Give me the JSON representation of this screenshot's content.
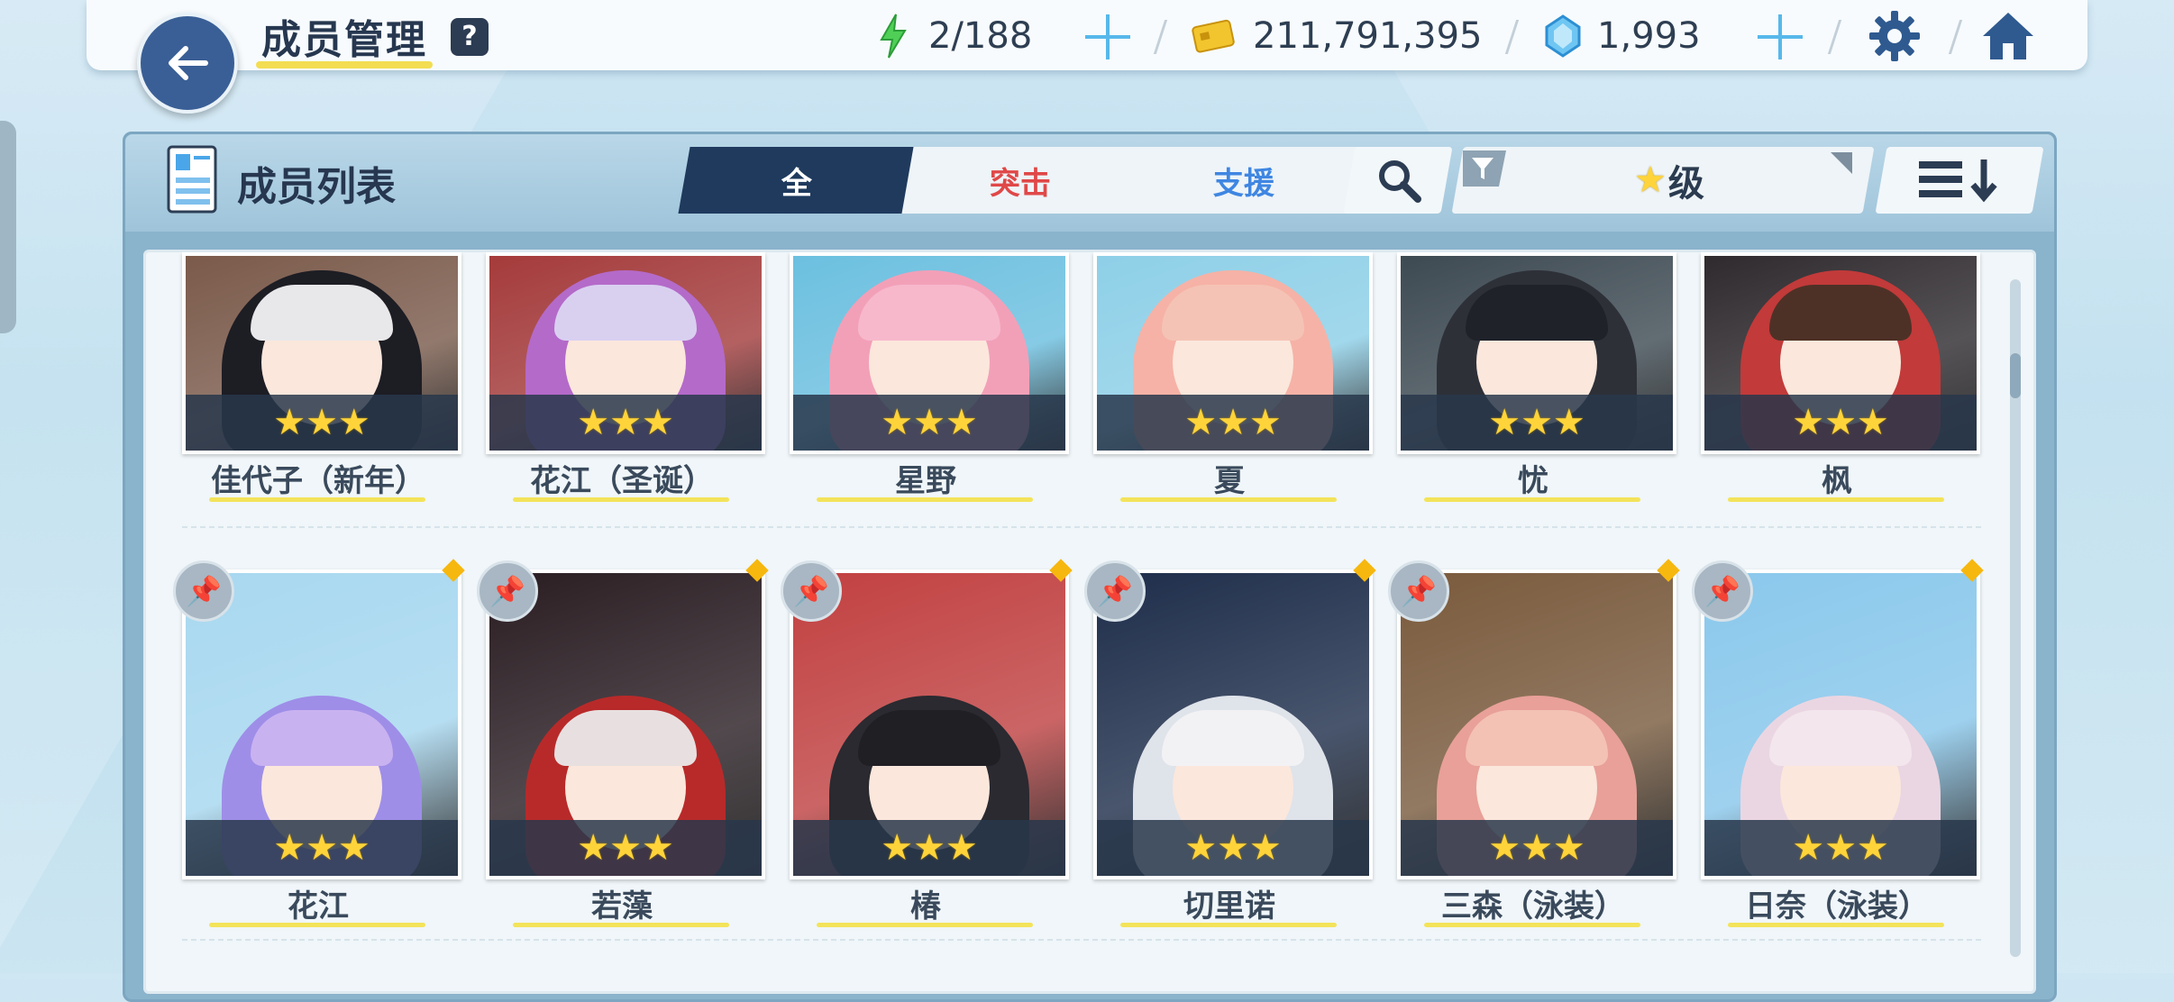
{
  "header": {
    "title": "成员管理",
    "help": "?",
    "ap": "2/188",
    "credits": "211,791,395",
    "gems": "1,993",
    "icons": [
      "back-arrow",
      "energy-bolt",
      "credit-card",
      "blue-gem",
      "gear",
      "home"
    ]
  },
  "panel": {
    "title": "成员列表",
    "tabs": [
      "全",
      "突击",
      "支援"
    ],
    "filter_label": "级",
    "colors": {
      "active_tab": "#1f3a5d",
      "assault": "#e04848",
      "support": "#3f86e2",
      "star": "#ffd43a"
    }
  },
  "students": [
    {
      "name": "佳代子（新年）",
      "stars": "★★★"
    },
    {
      "name": "花江（圣诞）",
      "stars": "★★★"
    },
    {
      "name": "星野",
      "stars": "★★★"
    },
    {
      "name": "夏",
      "stars": "★★★"
    },
    {
      "name": "忧",
      "stars": "★★★"
    },
    {
      "name": "枫",
      "stars": "★★★"
    },
    {
      "name": "花江",
      "stars": "★★★"
    },
    {
      "name": "若藻",
      "stars": "★★★"
    },
    {
      "name": "椿",
      "stars": "★★★"
    },
    {
      "name": "切里诺",
      "stars": "★★★"
    },
    {
      "name": "三森（泳装）",
      "stars": "★★★"
    },
    {
      "name": "日奈（泳装）",
      "stars": "★★★"
    }
  ]
}
